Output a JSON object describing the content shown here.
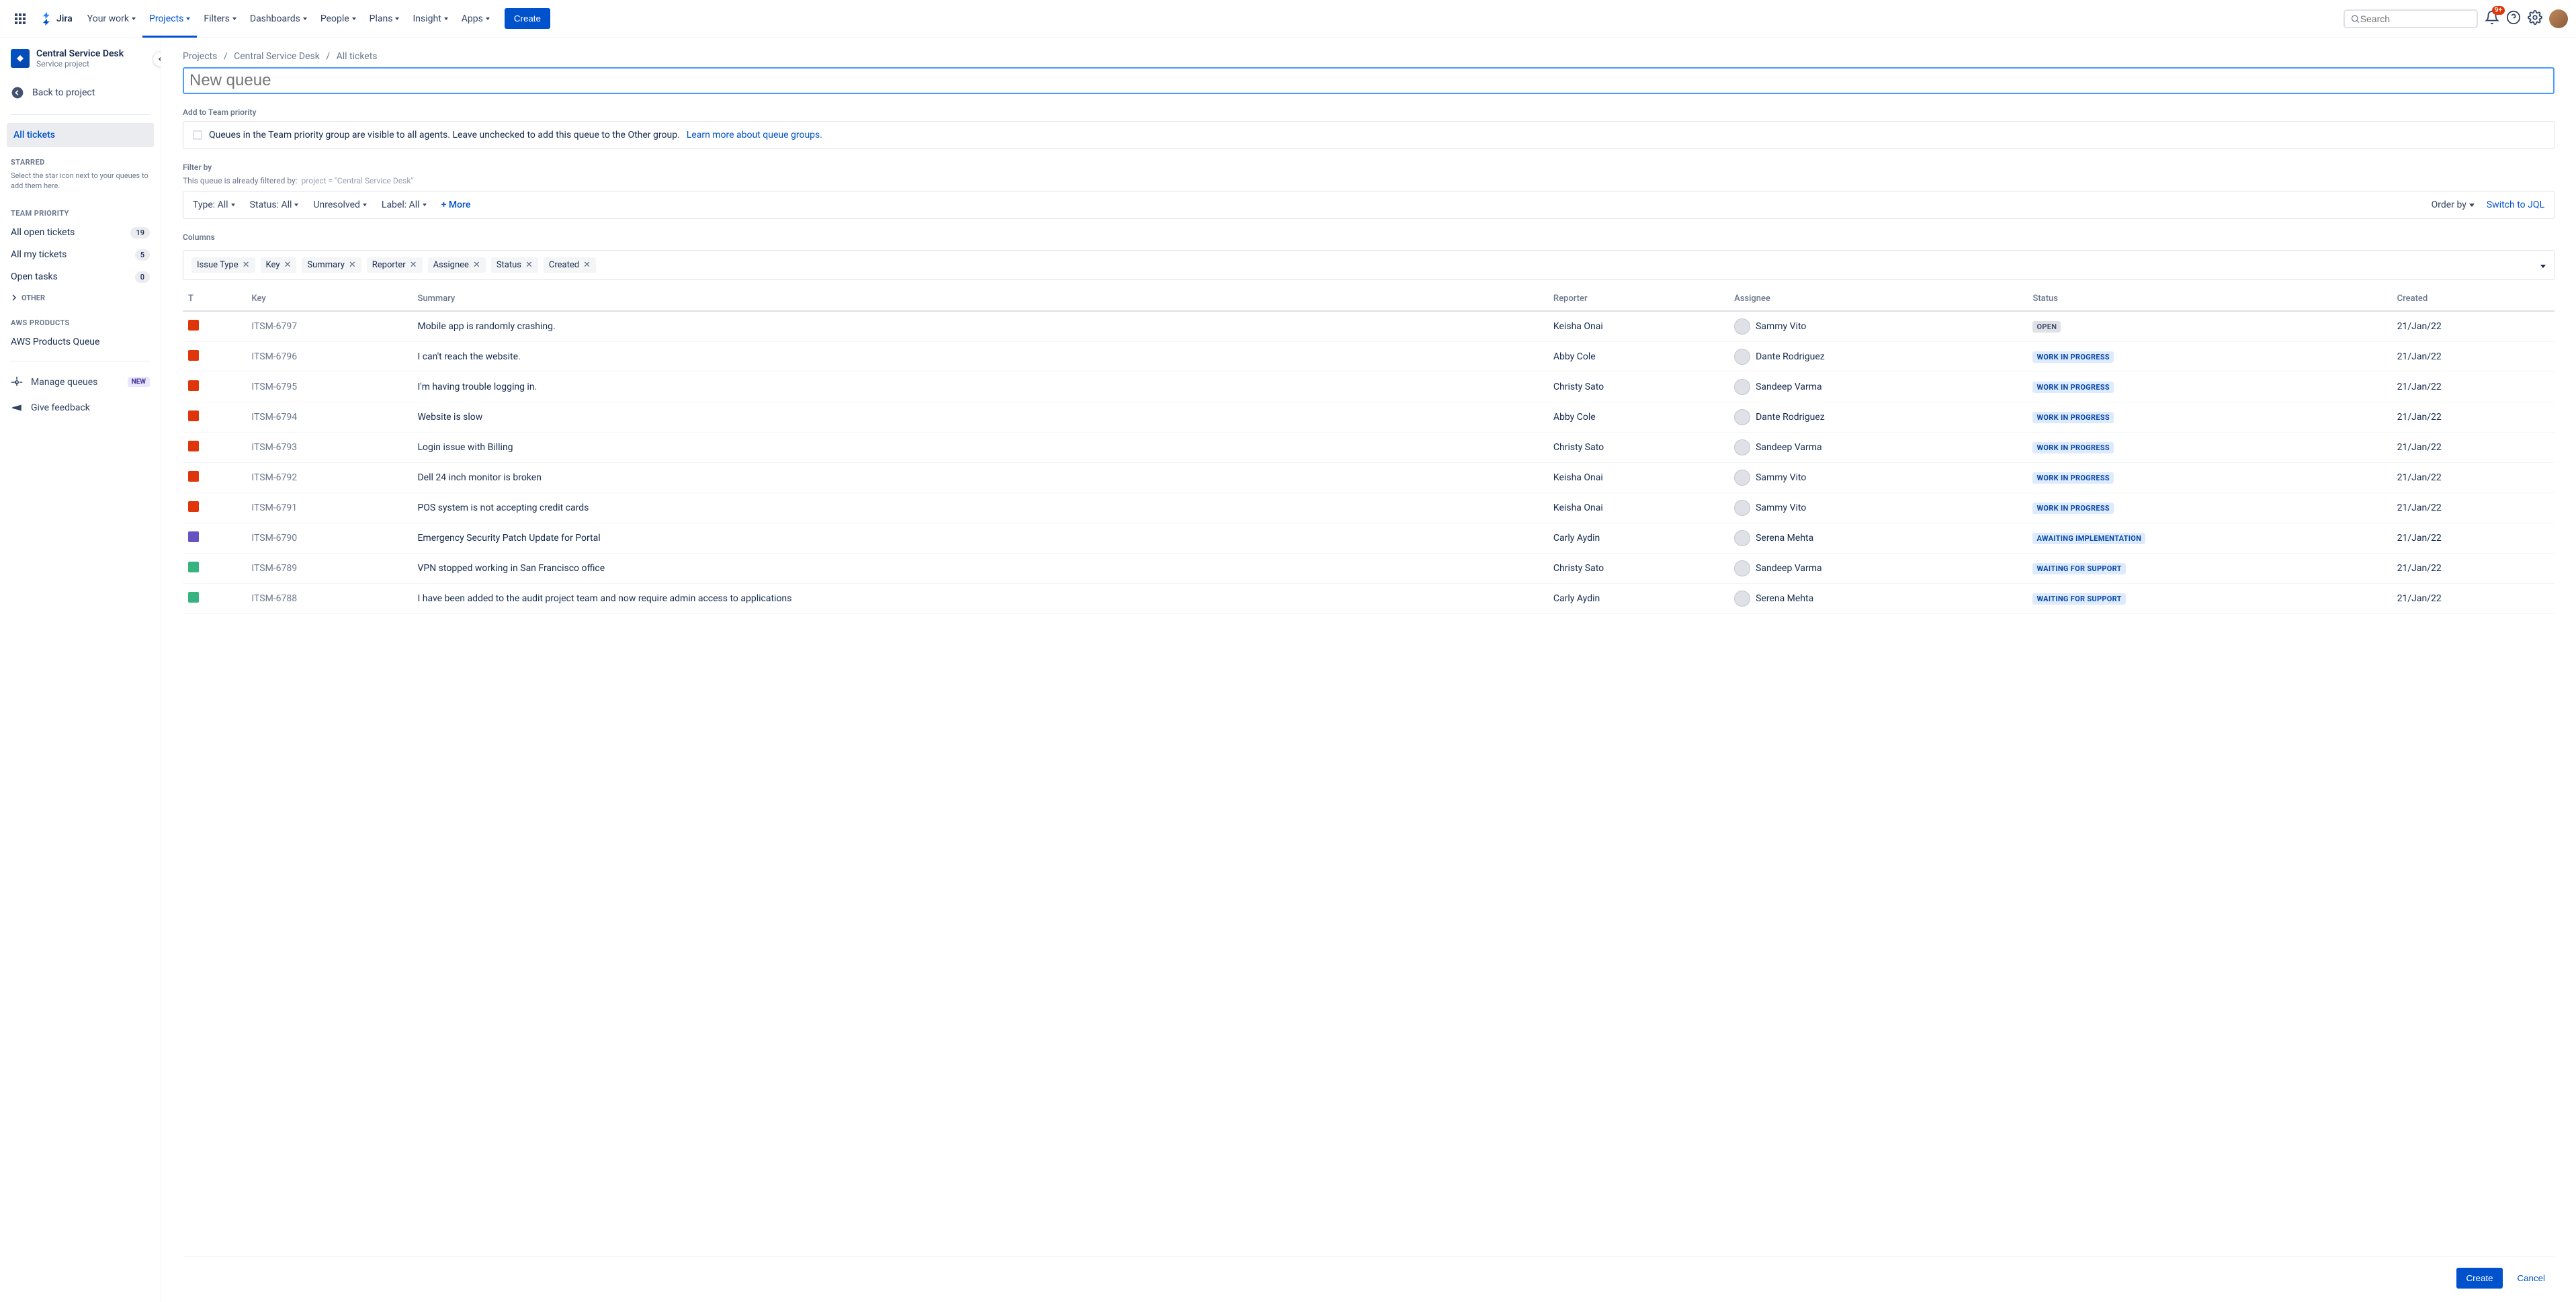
{
  "nav": {
    "items": [
      "Your work",
      "Projects",
      "Filters",
      "Dashboards",
      "People",
      "Plans",
      "Insight",
      "Apps"
    ],
    "activeIndex": 1,
    "createLabel": "Create",
    "searchPlaceholder": "Search",
    "notifBadge": "9+"
  },
  "logo": "Jira",
  "sidebar": {
    "projectTitle": "Central Service Desk",
    "projectSub": "Service project",
    "backLabel": "Back to project",
    "allTickets": "All tickets",
    "starredLabel": "STARRED",
    "starredHelp": "Select the star icon next to your queues to add them here.",
    "teamPriorityLabel": "TEAM PRIORITY",
    "queues": [
      {
        "name": "All open tickets",
        "count": "19"
      },
      {
        "name": "All my tickets",
        "count": "5"
      },
      {
        "name": "Open tasks",
        "count": "0"
      }
    ],
    "otherLabel": "OTHER",
    "awsLabel": "AWS PRODUCTS",
    "awsQueue": "AWS Products Queue",
    "manageQueues": "Manage queues",
    "newBadge": "NEW",
    "giveFeedback": "Give feedback"
  },
  "breadcrumbs": [
    "Projects",
    "Central Service Desk",
    "All tickets"
  ],
  "queueNamePlaceholder": "New queue",
  "teamPriority": {
    "title": "Add to Team priority",
    "text": "Queues in the Team priority group are visible to all agents. Leave unchecked to add this queue to the Other group.",
    "link": "Learn more about queue groups."
  },
  "filter": {
    "title": "Filter by",
    "help": "This queue is already filtered by:",
    "helpMono": "project = \"Central Service Desk\"",
    "chips": [
      "Type: All",
      "Status: All",
      "Unresolved",
      "Label: All"
    ],
    "more": "+ More",
    "orderBy": "Order by",
    "switchJql": "Switch to JQL"
  },
  "columns": {
    "title": "Columns",
    "chips": [
      "Issue Type",
      "Key",
      "Summary",
      "Reporter",
      "Assignee",
      "Status",
      "Created"
    ]
  },
  "table": {
    "headers": [
      "T",
      "Key",
      "Summary",
      "Reporter",
      "Assignee",
      "Status",
      "Created"
    ],
    "rows": [
      {
        "type": "red",
        "key": "ITSM-6797",
        "summary": "Mobile app is randomly crashing.",
        "reporter": "Keisha Onai",
        "assignee": "Sammy Vito",
        "status": "OPEN",
        "statusClass": "status-open",
        "created": "21/Jan/22"
      },
      {
        "type": "red",
        "key": "ITSM-6796",
        "summary": "I can't reach the website.",
        "reporter": "Abby Cole",
        "assignee": "Dante Rodriguez",
        "status": "WORK IN PROGRESS",
        "statusClass": "status-wip",
        "created": "21/Jan/22"
      },
      {
        "type": "red",
        "key": "ITSM-6795",
        "summary": "I'm having trouble logging in.",
        "reporter": "Christy Sato",
        "assignee": "Sandeep Varma",
        "status": "WORK IN PROGRESS",
        "statusClass": "status-wip",
        "created": "21/Jan/22"
      },
      {
        "type": "red",
        "key": "ITSM-6794",
        "summary": "Website is slow",
        "reporter": "Abby Cole",
        "assignee": "Dante Rodriguez",
        "status": "WORK IN PROGRESS",
        "statusClass": "status-wip",
        "created": "21/Jan/22"
      },
      {
        "type": "red",
        "key": "ITSM-6793",
        "summary": "Login issue with Billing",
        "reporter": "Christy Sato",
        "assignee": "Sandeep Varma",
        "status": "WORK IN PROGRESS",
        "statusClass": "status-wip",
        "created": "21/Jan/22"
      },
      {
        "type": "red",
        "key": "ITSM-6792",
        "summary": "Dell 24 inch monitor is broken",
        "reporter": "Keisha Onai",
        "assignee": "Sammy Vito",
        "status": "WORK IN PROGRESS",
        "statusClass": "status-wip",
        "created": "21/Jan/22"
      },
      {
        "type": "red",
        "key": "ITSM-6791",
        "summary": "POS system is not accepting credit cards",
        "reporter": "Keisha Onai",
        "assignee": "Sammy Vito",
        "status": "WORK IN PROGRESS",
        "statusClass": "status-wip",
        "created": "21/Jan/22"
      },
      {
        "type": "purple",
        "key": "ITSM-6790",
        "summary": "Emergency Security Patch Update for Portal",
        "reporter": "Carly Aydin",
        "assignee": "Serena Mehta",
        "status": "AWAITING IMPLEMENTATION",
        "statusClass": "status-await",
        "created": "21/Jan/22"
      },
      {
        "type": "green",
        "key": "ITSM-6789",
        "summary": "VPN stopped working in San Francisco office",
        "reporter": "Christy Sato",
        "assignee": "Sandeep Varma",
        "status": "WAITING FOR SUPPORT",
        "statusClass": "status-wait",
        "created": "21/Jan/22"
      },
      {
        "type": "green",
        "key": "ITSM-6788",
        "summary": "I have been added to the audit project team and now require admin access to applications",
        "reporter": "Carly Aydin",
        "assignee": "Serena Mehta",
        "status": "WAITING FOR SUPPORT",
        "statusClass": "status-wait",
        "created": "21/Jan/22"
      }
    ]
  },
  "footer": {
    "create": "Create",
    "cancel": "Cancel"
  }
}
